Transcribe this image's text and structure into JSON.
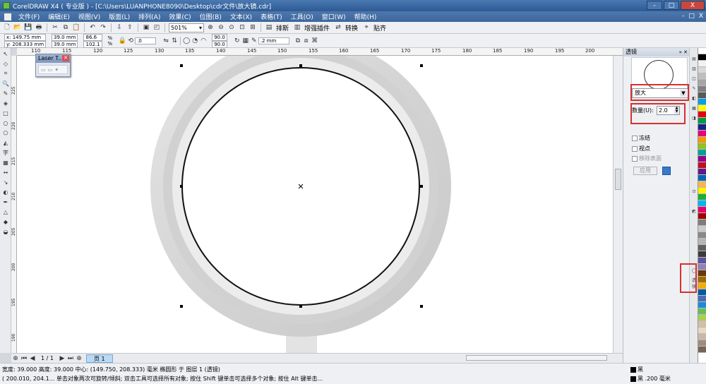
{
  "window": {
    "title": "CorelDRAW X4 ( 专业版 ) - [C:\\Users\\LUANPHONE8090\\Desktop\\cdr文件\\放大镜.cdr]",
    "controls": [
      "-",
      "□",
      "X"
    ]
  },
  "menu": {
    "items": [
      "文件(F)",
      "编辑(E)",
      "视图(V)",
      "版面(L)",
      "排列(A)",
      "效果(C)",
      "位图(B)",
      "文本(X)",
      "表格(T)",
      "工具(O)",
      "窗口(W)",
      "帮助(H)"
    ],
    "mdi_controls": [
      "-",
      "□",
      "X"
    ]
  },
  "toolbar": {
    "zoom_value": "501%",
    "launch_items": [
      "排斯",
      "增强插件",
      "转换",
      "贴齐"
    ]
  },
  "properties": {
    "x": "x: 149.75 mm",
    "y": "y: 208.333 mm",
    "w": "39.0 mm",
    "h": "39.0 mm",
    "scale_w": "86.6",
    "scale_h": "102.1",
    "pct": "%",
    "angle": ".0",
    "arc_start": "90.0",
    "arc_end": "90.0",
    "outline": ".2 mm"
  },
  "laser_window": {
    "title": "Laser T..."
  },
  "rulers": {
    "h": [
      "110",
      "115",
      "120",
      "125",
      "130",
      "135",
      "140",
      "145",
      "150",
      "155",
      "160",
      "165",
      "170",
      "175",
      "180",
      "185",
      "190",
      "195",
      "200"
    ],
    "v": [
      "225",
      "220",
      "215",
      "210",
      "205",
      "200",
      "195",
      "190"
    ]
  },
  "page_nav": {
    "counter": "1 / 1",
    "page_tab": "页 1"
  },
  "status": {
    "line1": "宽度: 39.000  高度: 39.000  中心: (149.750, 208.333)  毫米        椭圆形 于 图层 1 (透镜)",
    "line2": "( 200.010, 204.1...     单击对象两次可旋转/倾斜; 双击工具可选择所有对象; 按住 Shift 键单击可选择多个对象; 按住 Alt 键单击...",
    "fill_label": "黑",
    "outline_label": "黑  .200 毫米"
  },
  "docker": {
    "title": "透镜",
    "lens_type": "放大",
    "amount_label": "数量(U):",
    "amount_value": "2.0",
    "frozen_label": "冻结",
    "viewpoint_label": "视点",
    "remove_face_label": "移除表面",
    "apply_label": "应用",
    "side_tab": "透镜"
  },
  "palette": [
    "#ffffff",
    "#000000",
    "#f2f2f2",
    "#d9d9d9",
    "#bfbfbf",
    "#a6a6a6",
    "#808080",
    "#595959",
    "#00a0e9",
    "#ffff00",
    "#e60012",
    "#009944",
    "#1d2088",
    "#e4007f",
    "#f39800",
    "#8fc31f",
    "#00a29a",
    "#920783",
    "#c30d23",
    "#601986",
    "#0068b7",
    "#f8b551",
    "#fff100",
    "#22ac38",
    "#00b7ee",
    "#e5006a",
    "#a40000",
    "#7d7d7d",
    "#c9caca",
    "#898989",
    "#b5b5b6",
    "#606060",
    "#3e3a39",
    "#5f52a0",
    "#8f82bc",
    "#6a3906",
    "#9e6c00",
    "#f6ab00",
    "#005aaa",
    "#4c6cb3",
    "#1a8cd8",
    "#6cbb5a",
    "#aacf52",
    "#d1c0a5",
    "#ead7c5",
    "#c7b8a8",
    "#9d8e81",
    "#776655"
  ],
  "colors": {
    "accent_red": "#d63030",
    "title_blue": "#3d679c"
  }
}
